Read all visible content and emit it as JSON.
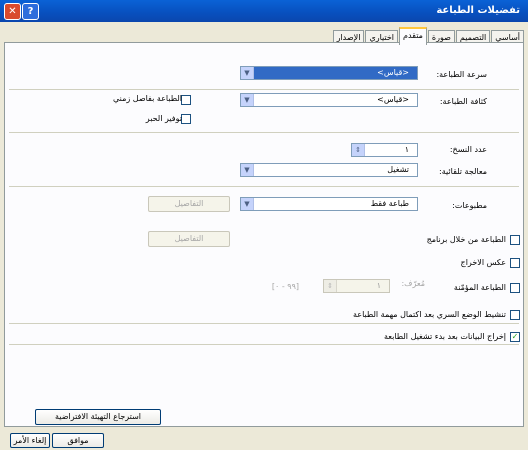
{
  "window": {
    "title": "تفضيلات الطباعة",
    "help_glyph": "?",
    "close_glyph": "✕"
  },
  "tabs": [
    {
      "label": "أساسي"
    },
    {
      "label": "التصميم"
    },
    {
      "label": "صورة"
    },
    {
      "label": "متقدم"
    },
    {
      "label": "اختياري"
    },
    {
      "label": "الإصدار"
    }
  ],
  "speed": {
    "label": "سرعة الطباعة:",
    "value": "<قياس>"
  },
  "density": {
    "label": "كثافة الطباعة:",
    "value": "<قياس>"
  },
  "timed_print": {
    "label": "الطباعة بفاصل زمني",
    "checked": false
  },
  "ink_save": {
    "label": "توفير الحبر",
    "checked": false
  },
  "copies": {
    "label": "عدد النسخ:",
    "value": "١"
  },
  "collate": {
    "label": "معالجة تلقائية:",
    "value": "تشغيل"
  },
  "prints": {
    "label": "مطبوعات:",
    "value": "طباعة فقط",
    "details_label": "التفاصيل"
  },
  "print_via_program": {
    "label": "الطباعة من خلال برنامج",
    "checked": false,
    "details_label": "التفاصيل"
  },
  "reverse_output": {
    "label": "عكس الاخراج",
    "checked": false
  },
  "stored_print": {
    "label": "الطباعة المؤمّنة",
    "checked": false,
    "id_label": "مُعرّف:",
    "id_value": "١",
    "range": "[٩٩ - ٠]"
  },
  "secret_mode": {
    "label": "تنشيط الوضع السري بعد اكتمال مهمة الطباعة",
    "checked": false
  },
  "output_data": {
    "label": "إخراج البيانات بعد بدء تشغيل الطابعة",
    "checked": true
  },
  "restore_defaults_label": "استرجاع التهيئة الافتراضية",
  "ok_label": "موافق",
  "cancel_label": "إلغاء الأمر",
  "colors": {
    "titlebar": "#0a5bd3",
    "face": "#ece9d8",
    "panel": "#fcfcfe",
    "selection": "#316ac5",
    "check": "#21a121"
  }
}
